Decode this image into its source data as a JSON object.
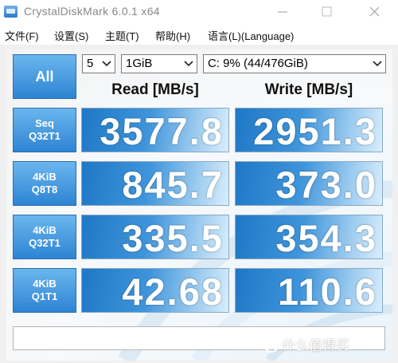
{
  "window": {
    "title": "CrystalDiskMark 6.0.1 x64"
  },
  "menu": [
    "文件(F)",
    "设置(S)",
    "主题(T)",
    "帮助(H)",
    "语言(L)(Language)"
  ],
  "controls": {
    "all_button": "All",
    "count": "5",
    "size": "1GiB",
    "drive": "C: 9% (44/476GiB)"
  },
  "headers": {
    "read": "Read [MB/s]",
    "write": "Write [MB/s]"
  },
  "tests": [
    {
      "line1": "Seq",
      "line2": "Q32T1",
      "read": "3577.8",
      "write": "2951.3"
    },
    {
      "line1": "4KiB",
      "line2": "Q8T8",
      "read": "845.7",
      "write": "373.0"
    },
    {
      "line1": "4KiB",
      "line2": "Q32T1",
      "read": "335.5",
      "write": "354.3"
    },
    {
      "line1": "4KiB",
      "line2": "Q1T1",
      "read": "42.68",
      "write": "110.6"
    }
  ],
  "watermark": "什么值得买",
  "colors": {
    "button_blue": "#2e84d3",
    "cell_blue": "#1f78c6"
  }
}
